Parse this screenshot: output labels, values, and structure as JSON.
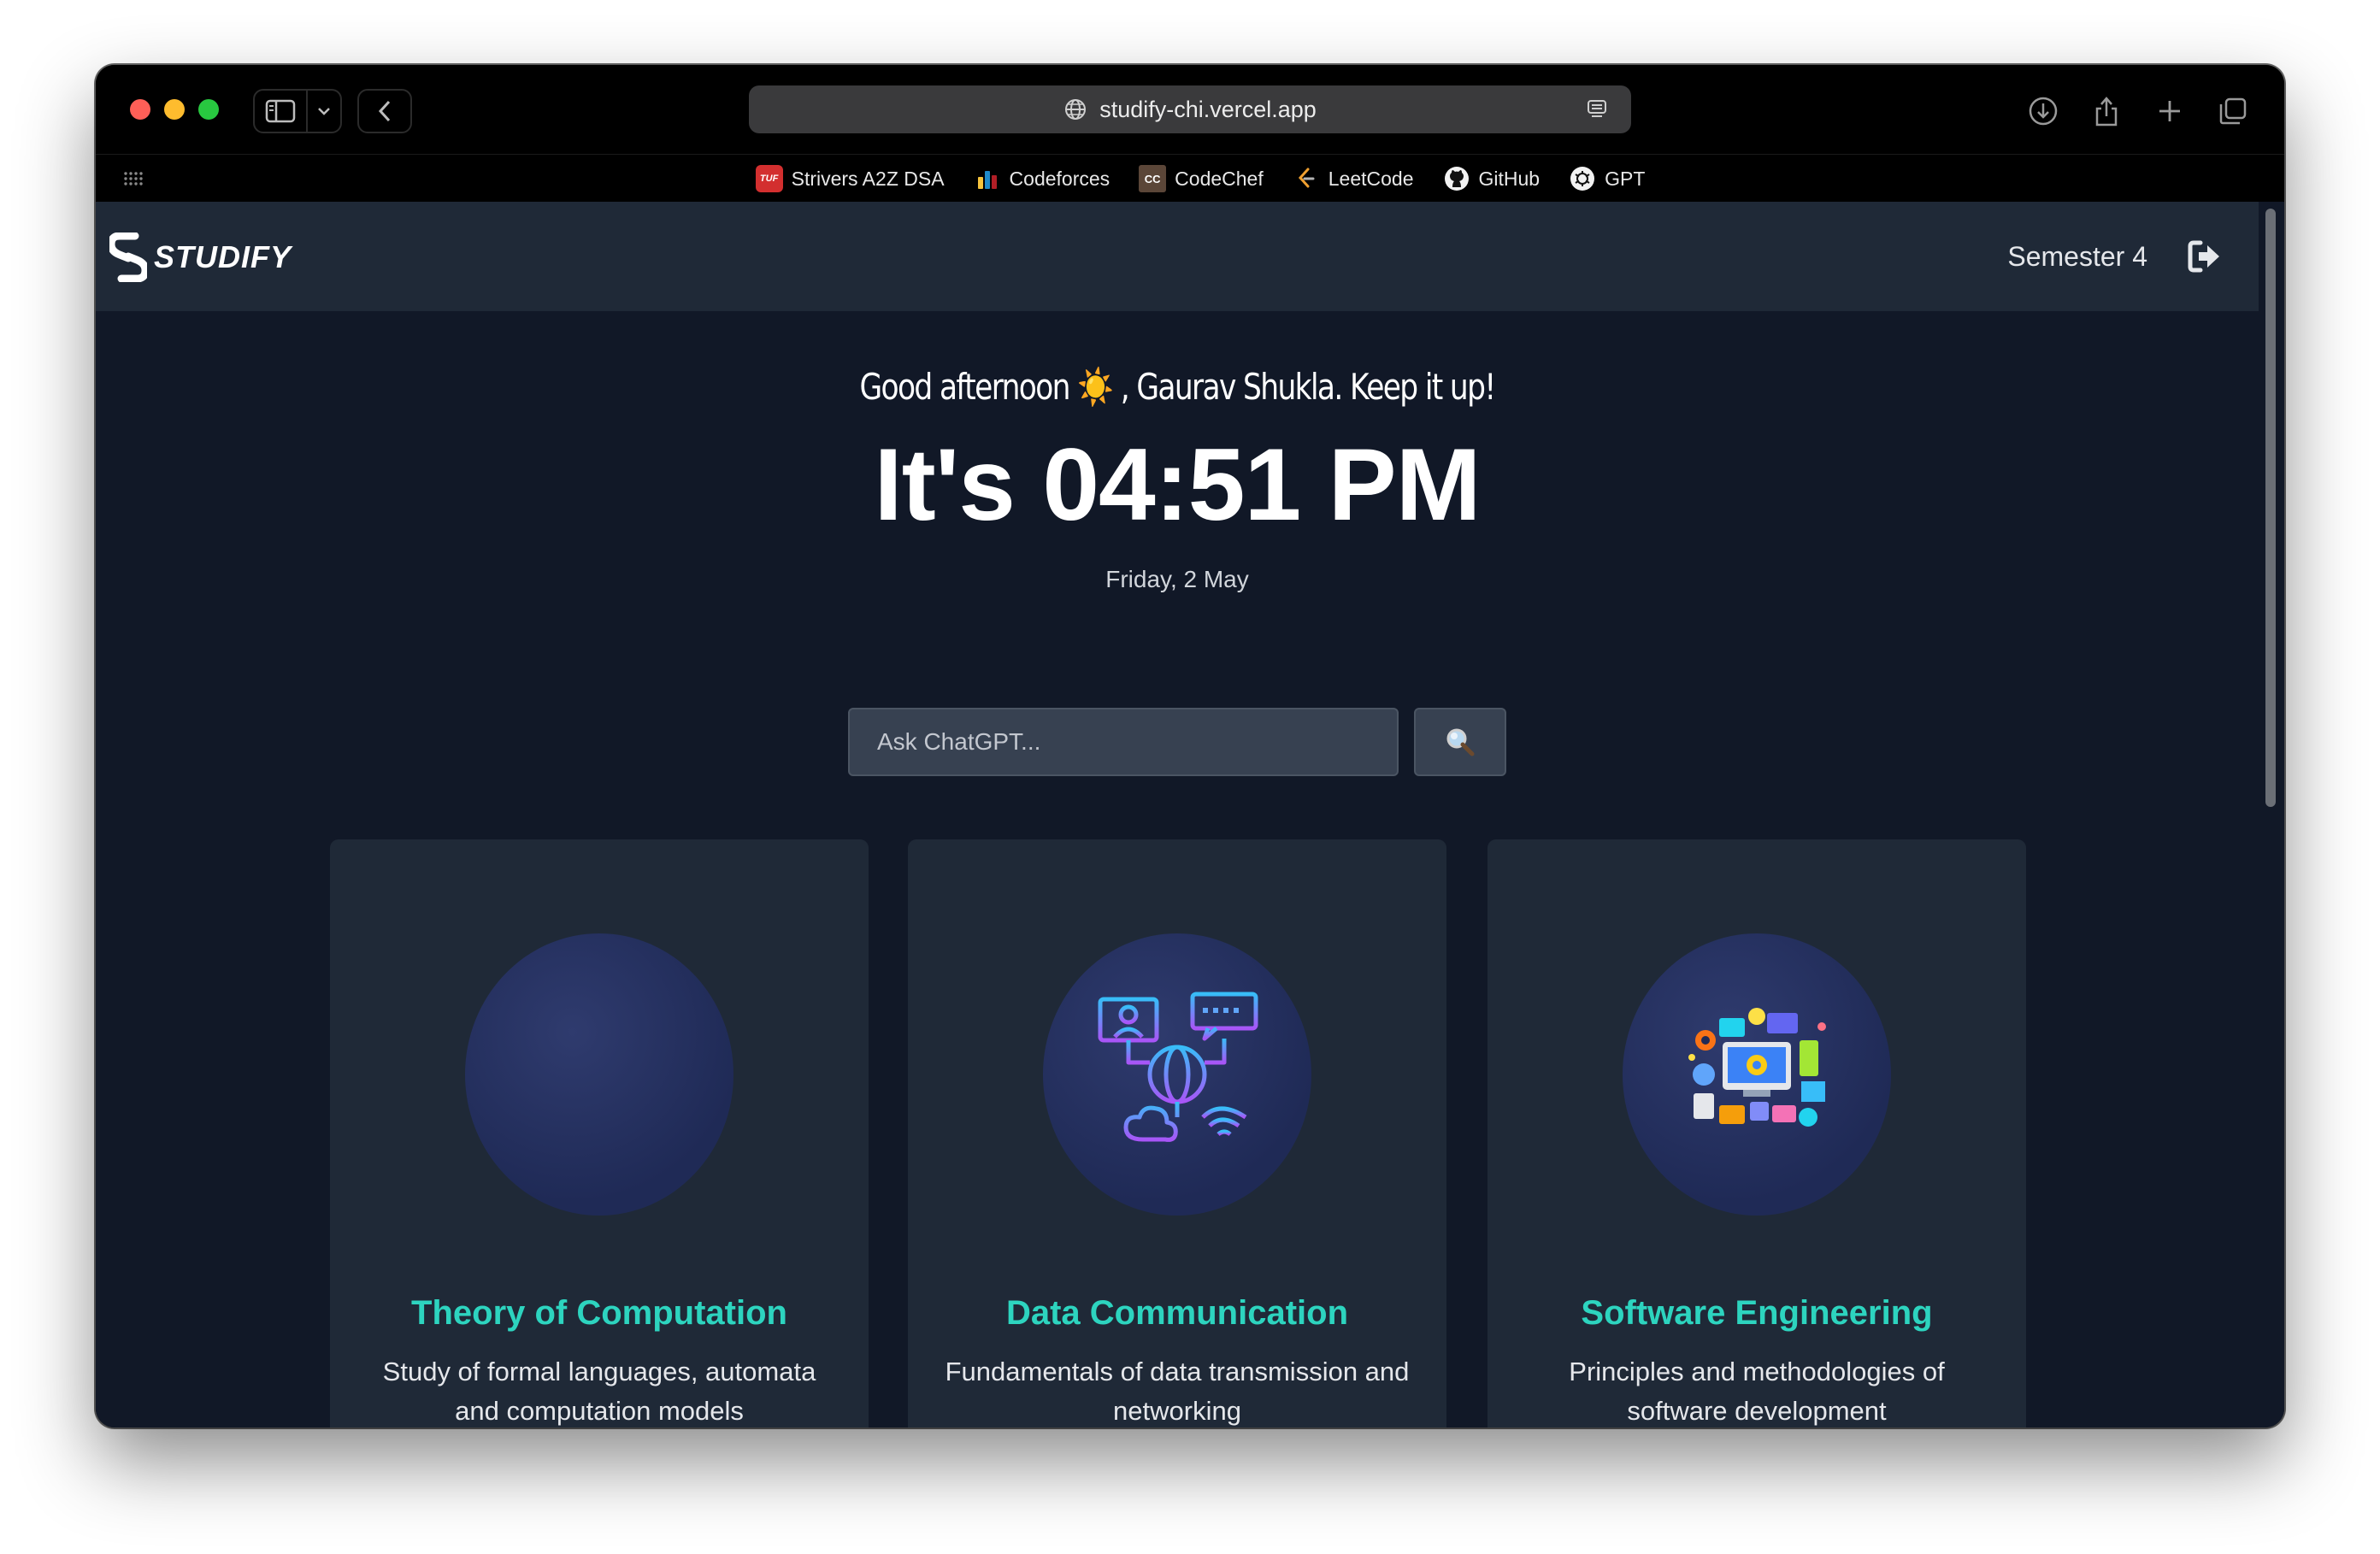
{
  "browser": {
    "url": "studify-chi.vercel.app",
    "bookmarks": [
      {
        "label": "Strivers A2Z DSA",
        "icon": "tuf-icon",
        "badge": "TUF"
      },
      {
        "label": "Codeforces",
        "icon": "codeforces-icon"
      },
      {
        "label": "CodeChef",
        "icon": "codechef-icon",
        "badge": "CC"
      },
      {
        "label": "LeetCode",
        "icon": "leetcode-icon"
      },
      {
        "label": "GitHub",
        "icon": "github-icon"
      },
      {
        "label": "GPT",
        "icon": "openai-icon"
      }
    ]
  },
  "navbar": {
    "logo_text": "STUDIFY",
    "semester": "Semester 4",
    "logout_icon": "logout-icon"
  },
  "hero": {
    "greeting": "Good afternoon ☀️ , Gaurav Shukla. Keep it up!",
    "time": "It's 04:51 PM",
    "date": "Friday, 2 May"
  },
  "search": {
    "placeholder": "Ask ChatGPT...",
    "button_icon": "🔍"
  },
  "subjects": [
    {
      "title": "Theory of Computation",
      "description": "Study of formal languages, automata and computation models"
    },
    {
      "title": "Data Communication",
      "description": "Fundamentals of data transmission and networking"
    },
    {
      "title": "Software Engineering",
      "description": "Principles and methodologies of software development"
    }
  ],
  "colors": {
    "page_bg": "#111827",
    "navbar_bg": "#1f2937",
    "card_bg": "#1f2937",
    "accent_teal": "#2dd4bf"
  }
}
